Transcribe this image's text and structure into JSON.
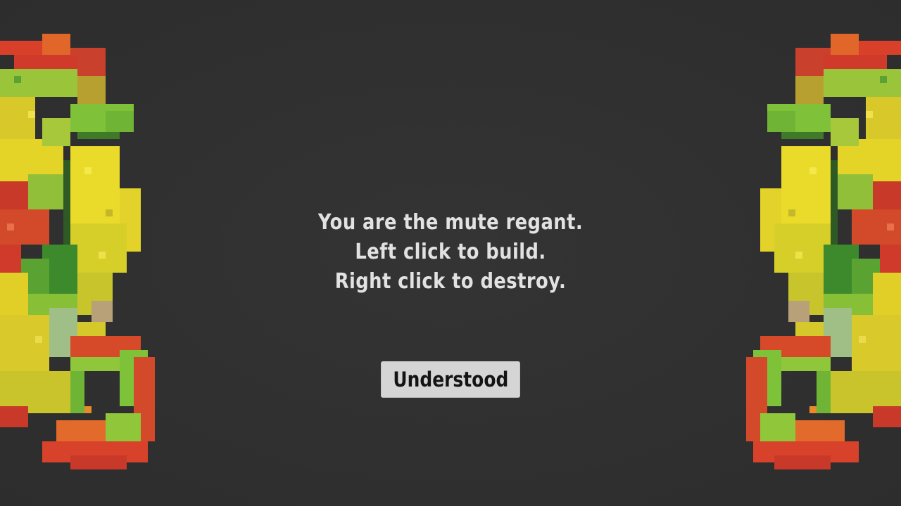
{
  "tutorial": {
    "lines": [
      "You are the mute regant.",
      "Left click to build.",
      "Right click to destroy."
    ],
    "button_label": "Understood"
  },
  "decorations": {
    "left": "seahorse-dragon-sprite",
    "right": "seahorse-dragon-sprite"
  },
  "colors": {
    "background": "#303030",
    "text": "#e2e2e2",
    "button_bg": "#d5d5d5",
    "button_text": "#141414"
  }
}
